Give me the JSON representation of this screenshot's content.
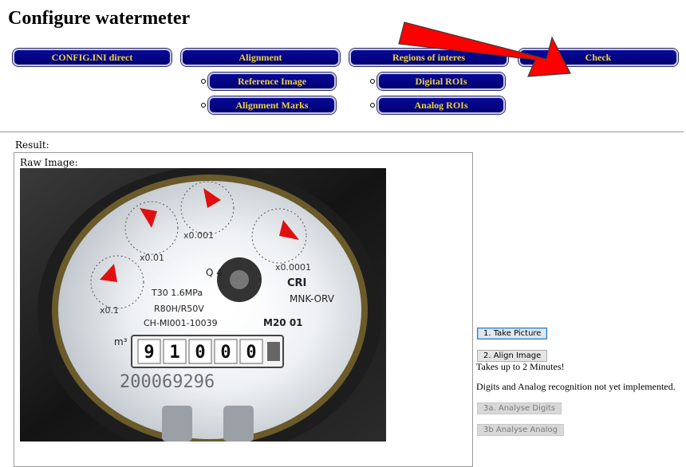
{
  "page": {
    "title": "Configure watermeter"
  },
  "nav": {
    "top": [
      "CONFIG.INI direct",
      "Alignment",
      "Regions of interes",
      "Check"
    ],
    "alignment_sub": [
      "Reference Image",
      "Alignment Marks"
    ],
    "roi_sub": [
      "Digital ROIs",
      "Analog ROIs"
    ]
  },
  "result": {
    "label": "Result:",
    "raw_label": "Raw Image:"
  },
  "meter": {
    "counter_digits": [
      "9",
      "1",
      "0",
      "0",
      "0"
    ],
    "model": "MNK-ORV",
    "brand": "CRI",
    "class_code": "R80H/R50V",
    "temp_pressure": "T30  1.6MPa",
    "serial_code": "CH-MI001-10039",
    "size": "M20 01",
    "q_mark": "Q 4",
    "unit": "m³",
    "serial_number": "200069296",
    "dial_labels": [
      "x0.1",
      "x0.01",
      "x0.001",
      "x0.0001"
    ]
  },
  "actions": {
    "take_picture": "1. Take Picture",
    "align_image": "2. Align Image",
    "align_note": "Takes up to 2 Minutes!",
    "recognition_note": "Digits and Analog recognition not yet implemented.",
    "analyse_digits": "3a. Analyse Digits",
    "analyse_analog": "3b Analyse Analog"
  },
  "colors": {
    "nav_bg": "#00007a",
    "nav_text": "#f0d23a",
    "arrow": "#ff0000"
  }
}
